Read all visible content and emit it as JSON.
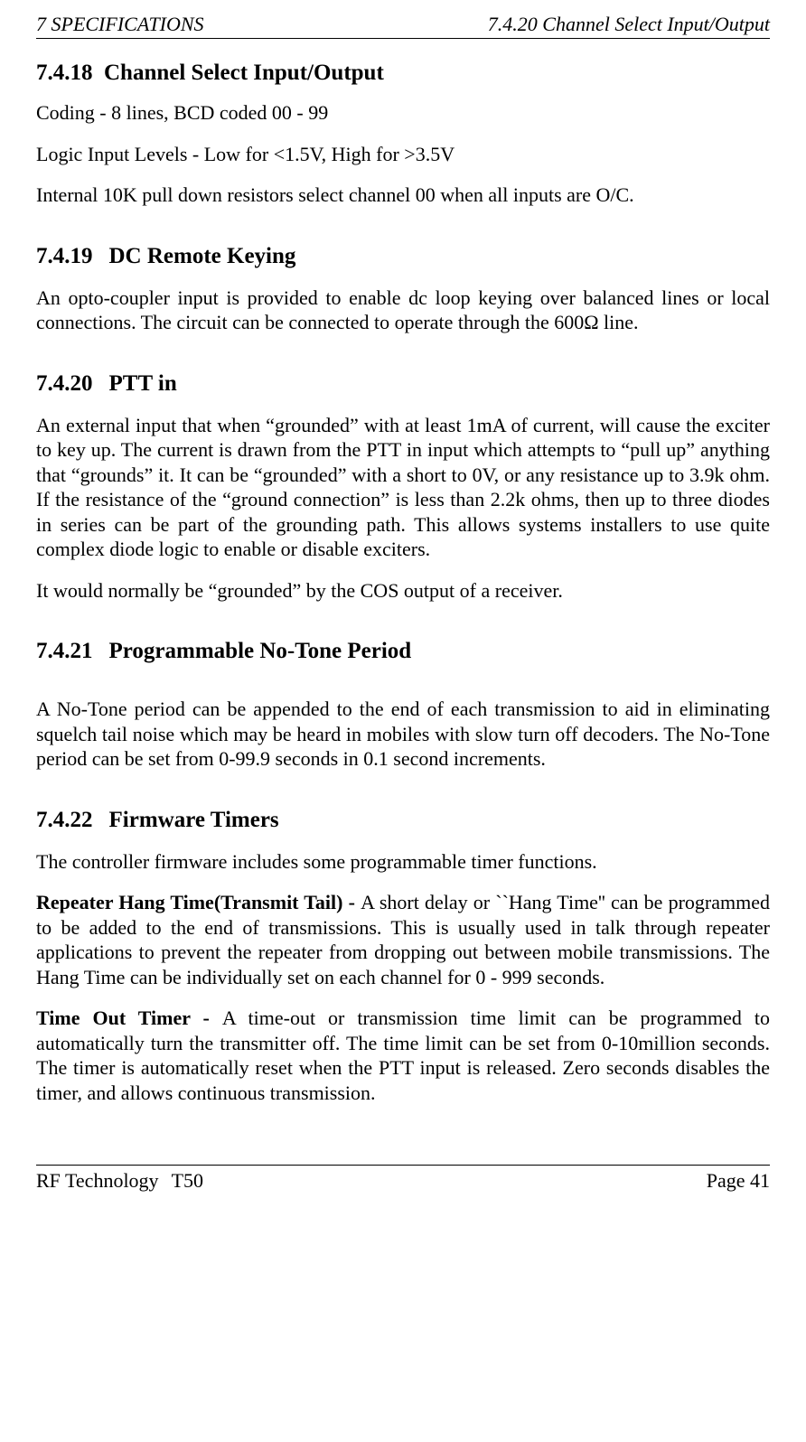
{
  "header": {
    "left": "7  SPECIFICATIONS",
    "right": "7.4.20  Channel Select Input/Output"
  },
  "sections": {
    "s7418": {
      "num": "7.4.18",
      "title": "Channel Select Input/Output",
      "p1": "Coding - 8 lines, BCD coded 00 - 99",
      "p2": "Logic Input Levels - Low for <1.5V, High for >3.5V",
      "p3": "Internal 10K pull down resistors select channel 00 when all inputs are O/C."
    },
    "s7419": {
      "num": "7.4.19",
      "title": "DC Remote Keying",
      "p1": "An opto-coupler input is provided to enable dc loop keying over balanced lines or local connections.  The circuit can be connected to operate through the 600Ω line."
    },
    "s7420": {
      "num": "7.4.20",
      "title": "PTT in",
      "p1": "An external input that when “grounded” with at least 1mA of current, will cause the exciter to key up.  The current is drawn from the PTT in input which attempts to “pull up” anything that “grounds” it.  It can be “grounded” with a short to 0V, or any resistance up to 3.9k ohm.  If the resistance of the “ground connection” is less than 2.2k ohms, then up to three diodes in series can be part of the grounding path.  This allows systems installers to use quite complex diode logic to enable or disable exciters.",
      "p2": "It would normally be “grounded” by the COS output of a receiver."
    },
    "s7421": {
      "num": "7.4.21",
      "title": "Programmable No-Tone Period",
      "p1": "A No-Tone period can be appended to the end of each transmission to aid in eliminating squelch tail noise which may be heard in mobiles with slow turn off decoders.  The No-Tone period can be set from 0-99.9 seconds in 0.1 second increments."
    },
    "s7422": {
      "num": "7.4.22",
      "title": "Firmware Timers",
      "p1": "The controller firmware includes some programmable timer functions.",
      "p2_label": "Repeater Hang Time(Transmit Tail) - ",
      "p2_body": "A short delay or ``Hang Time'' can be programmed to be added to the end of transmissions.  This is usually used in talk through repeater applications to prevent the repeater from dropping out between mobile transmissions.  The Hang Time can be individually set on each channel for 0 - 999 seconds.",
      "p3_label": "Time Out Timer - ",
      "p3_body": "A time-out or transmission time limit can be programmed to automatically turn the transmitter off.  The time limit can be set from 0-10million seconds.  The timer is automatically reset when the PTT input is released.  Zero seconds disables the timer, and allows continuous transmission."
    }
  },
  "footer": {
    "left_a": "RF Technology",
    "left_b": "T50",
    "right": "Page 41"
  }
}
